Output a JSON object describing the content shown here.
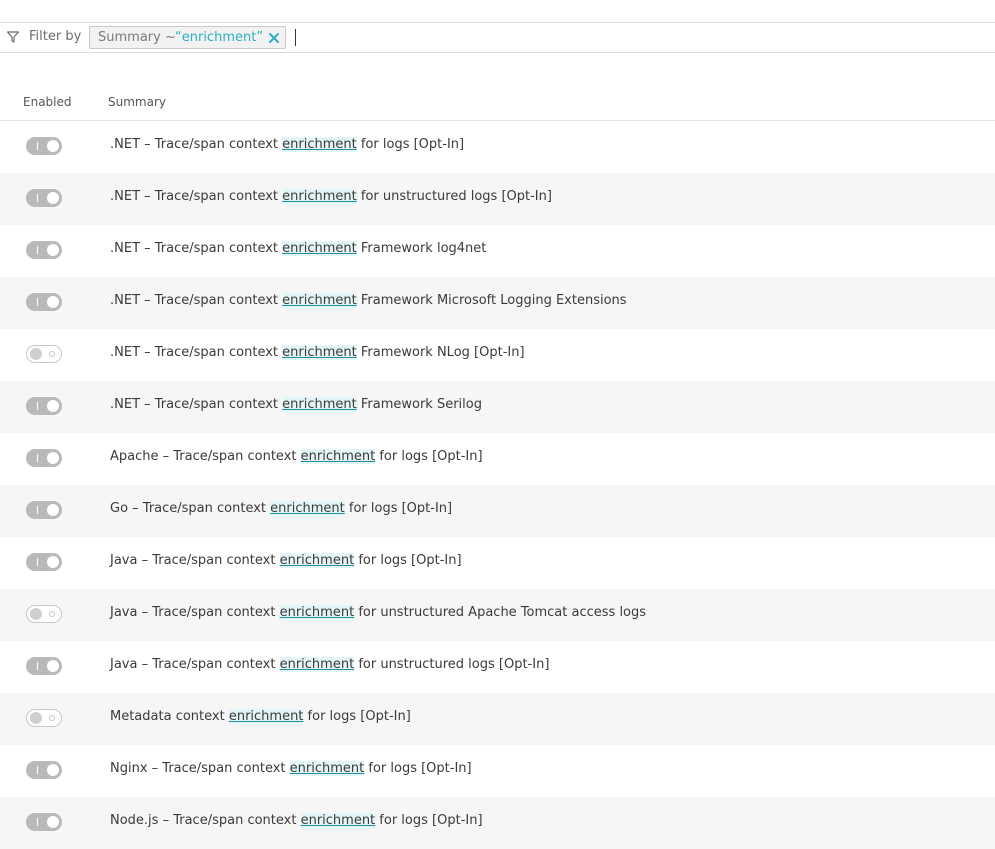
{
  "filter": {
    "label": "Filter by",
    "chip_key": "Summary ~",
    "chip_value": "“enrichment”"
  },
  "columns": {
    "enabled": "Enabled",
    "summary": "Summary"
  },
  "highlight_term": "enrichment",
  "rows": [
    {
      "enabled": true,
      "pre": ".NET – Trace/span context ",
      "match": "enrichment",
      "post": " for logs [Opt-In]"
    },
    {
      "enabled": true,
      "pre": ".NET – Trace/span context ",
      "match": "enrichment",
      "post": " for unstructured logs [Opt-In]"
    },
    {
      "enabled": true,
      "pre": ".NET – Trace/span context ",
      "match": "enrichment",
      "post": " Framework log4net"
    },
    {
      "enabled": true,
      "pre": ".NET – Trace/span context ",
      "match": "enrichment",
      "post": " Framework Microsoft Logging Extensions"
    },
    {
      "enabled": false,
      "pre": ".NET – Trace/span context ",
      "match": "enrichment",
      "post": " Framework NLog [Opt-In]"
    },
    {
      "enabled": true,
      "pre": ".NET – Trace/span context ",
      "match": "enrichment",
      "post": " Framework Serilog"
    },
    {
      "enabled": true,
      "pre": "Apache – Trace/span context ",
      "match": "enrichment",
      "post": " for logs [Opt-In]"
    },
    {
      "enabled": true,
      "pre": "Go – Trace/span context ",
      "match": "enrichment",
      "post": " for logs [Opt-In]"
    },
    {
      "enabled": true,
      "pre": "Java – Trace/span context ",
      "match": "enrichment",
      "post": " for logs [Opt-In]"
    },
    {
      "enabled": false,
      "pre": "Java – Trace/span context ",
      "match": "enrichment",
      "post": " for unstructured Apache Tomcat access logs"
    },
    {
      "enabled": true,
      "pre": "Java – Trace/span context ",
      "match": "enrichment",
      "post": " for unstructured logs [Opt-In]"
    },
    {
      "enabled": false,
      "pre": "Metadata context ",
      "match": "enrichment",
      "post": " for logs [Opt-In]"
    },
    {
      "enabled": true,
      "pre": "Nginx – Trace/span context ",
      "match": "enrichment",
      "post": " for logs [Opt-In]"
    },
    {
      "enabled": true,
      "pre": "Node.js – Trace/span context ",
      "match": "enrichment",
      "post": " for logs [Opt-In]"
    }
  ],
  "icons": {
    "filter": "filter-funnel-icon",
    "chip_close": "close-x-icon"
  },
  "colors": {
    "accent": "#2ab0c4",
    "toggle_on": "#b9b9b9",
    "highlight_bg": "#e4f5f7"
  }
}
